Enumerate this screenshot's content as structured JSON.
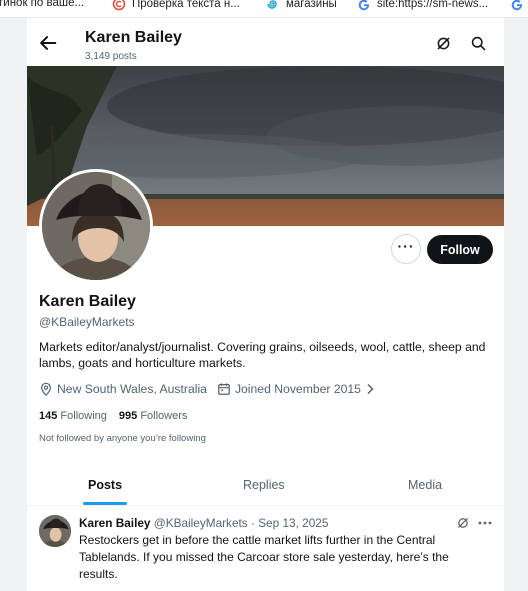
{
  "bookmarks": [
    {
      "label": "тинок по ваше...",
      "icon": "page-icon"
    },
    {
      "label": "Проверка текста н...",
      "icon": "copyright-icon"
    },
    {
      "label": "магазины",
      "icon": "spiral-icon"
    },
    {
      "label": "site:https://sm-news...",
      "icon": "google-icon"
    }
  ],
  "header": {
    "name": "Karen Bailey",
    "post_count": "3,149 posts"
  },
  "profile": {
    "name": "Karen Bailey",
    "handle": "@KBaileyMarkets",
    "bio": "Markets editor/analyst/journalist. Covering grains, oilseeds, wool, cattle, sheep and lambs, goats and horticulture markets.",
    "location": "New South Wales, Australia",
    "joined": "Joined November 2015",
    "following_count": "145",
    "following_label": "Following",
    "followers_count": "995",
    "followers_label": "Followers",
    "not_followed": "Not followed by anyone you’re following",
    "follow_label": "Follow",
    "more_label": "···"
  },
  "tabs": [
    {
      "label": "Posts",
      "active": true
    },
    {
      "label": "Replies",
      "active": false
    },
    {
      "label": "Media",
      "active": false
    }
  ],
  "tweet": {
    "name": "Karen Bailey",
    "handle": "@KBaileyMarkets",
    "date": "· Sep 13, 2025",
    "text": "Restockers get in before the cattle market lifts further in the Central Tablelands. If you missed the Carcoar store sale yesterday, here’s the results."
  },
  "colors": {
    "accent": "#1d9bf0",
    "text": "#0f1419",
    "muted": "#536471"
  }
}
